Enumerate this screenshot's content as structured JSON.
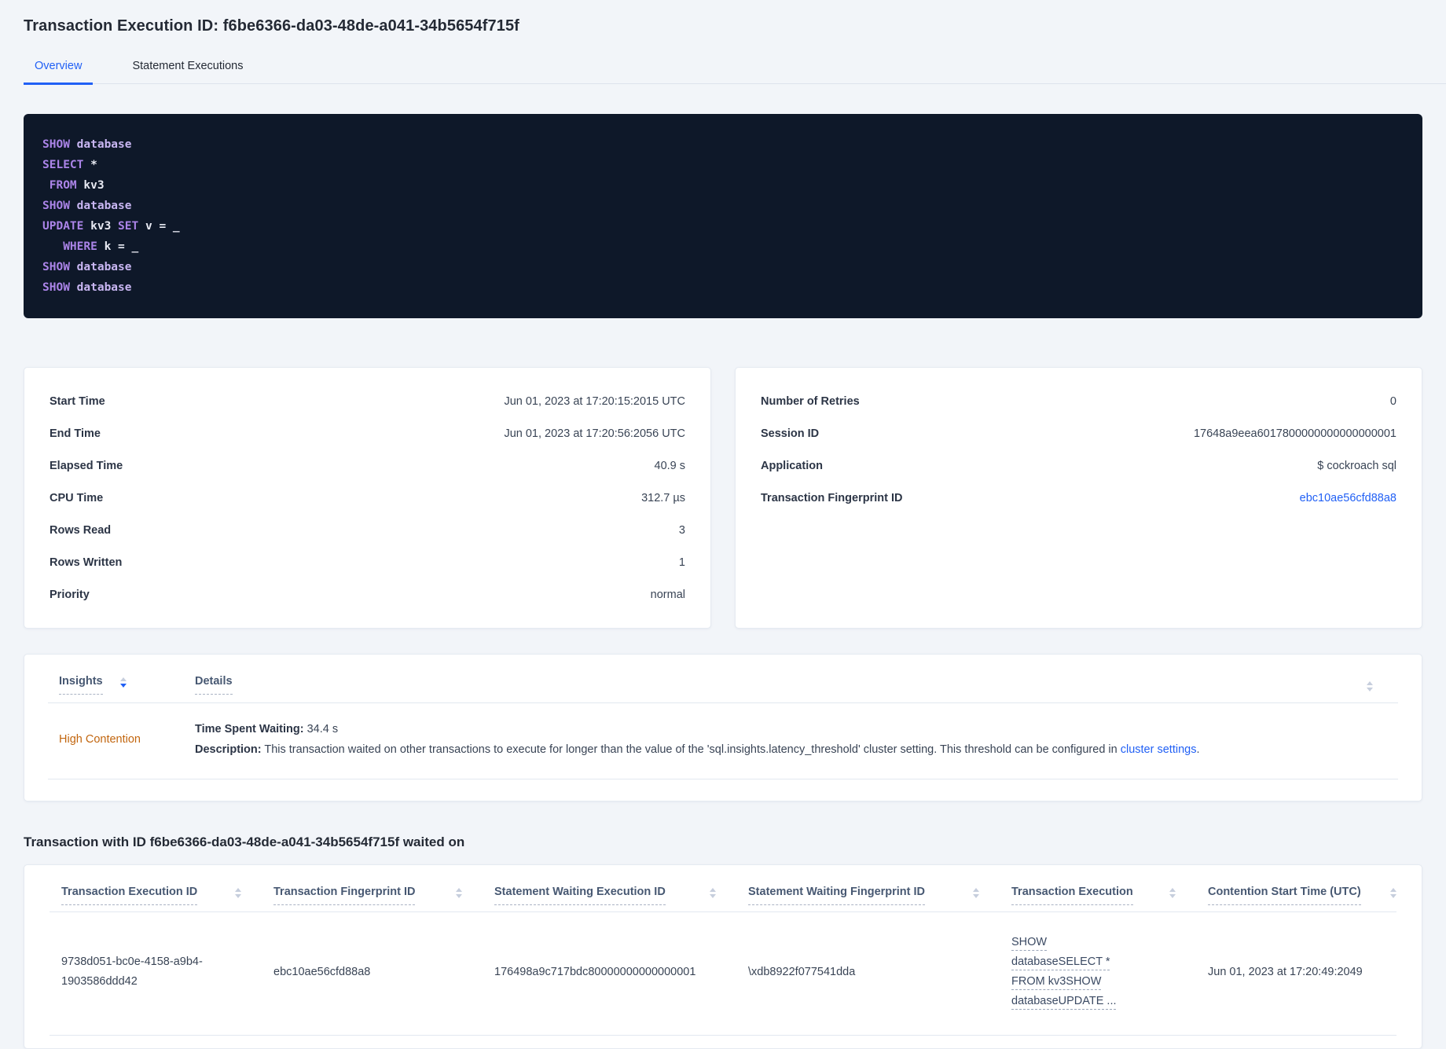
{
  "title": "Transaction Execution ID: f6be6366-da03-48de-a041-34b5654f715f",
  "tabs": {
    "overview": "Overview",
    "statements": "Statement Executions"
  },
  "sql": {
    "l1": [
      "SHOW",
      " database"
    ],
    "l2": [
      "SELECT",
      " *"
    ],
    "l3": [
      " FROM",
      " kv3"
    ],
    "l4": [
      "SHOW",
      " database"
    ],
    "l5": [
      "UPDATE",
      " kv3 ",
      "SET",
      " v = _"
    ],
    "l6": [
      "   WHERE",
      " k = _"
    ],
    "l7": [
      "SHOW",
      " database"
    ],
    "l8": [
      "SHOW",
      " database"
    ]
  },
  "summary": {
    "rows": [
      {
        "label": "Start Time",
        "value": "Jun 01, 2023 at 17:20:15:2015 UTC"
      },
      {
        "label": "End Time",
        "value": "Jun 01, 2023 at 17:20:56:2056 UTC"
      },
      {
        "label": "Elapsed Time",
        "value": "40.9 s"
      },
      {
        "label": "CPU Time",
        "value": "312.7 µs"
      },
      {
        "label": "Rows Read",
        "value": "3"
      },
      {
        "label": "Rows Written",
        "value": "1"
      },
      {
        "label": "Priority",
        "value": "normal"
      }
    ]
  },
  "meta": {
    "rows": [
      {
        "label": "Number of Retries",
        "value": "0"
      },
      {
        "label": "Session ID",
        "value": "17648a9eea6017800000000000000001"
      },
      {
        "label": "Application",
        "value": "$ cockroach sql"
      }
    ],
    "fingerprint_label": "Transaction Fingerprint ID",
    "fingerprint_value": "ebc10ae56cfd88a8"
  },
  "insights": {
    "col_insights": "Insights",
    "col_details": "Details",
    "row": {
      "name": "High Contention",
      "waiting_label": "Time Spent Waiting:",
      "waiting_value": " 34.4 s",
      "desc_label": "Description:",
      "desc_before": " This transaction waited on other transactions to execute for longer than the value of the 'sql.insights.latency_threshold' cluster setting. This threshold can be configured in ",
      "desc_link": "cluster settings",
      "desc_after": "."
    }
  },
  "waited": {
    "heading": "Transaction with ID f6be6366-da03-48de-a041-34b5654f715f waited on",
    "columns": [
      "Transaction Execution ID",
      "Transaction Fingerprint ID",
      "Statement Waiting Execution ID",
      "Statement Waiting Fingerprint ID",
      "Transaction Execution",
      "Contention Start Time (UTC)"
    ],
    "row": {
      "transaction_execution_id": "9738d051-bc0e-4158-a9b4-1903586ddd42",
      "transaction_fingerprint_id": "ebc10ae56cfd88a8",
      "statement_waiting_execution_id": "176498a9c717bdc80000000000000001",
      "statement_waiting_fingerprint_id": "\\xdb8922f077541dda",
      "transaction_execution": "SHOW databaseSELECT * FROM kv3SHOW databaseUPDATE ...",
      "contention_start_time": "Jun 01, 2023 at 17:20:49:2049"
    }
  },
  "colors": {
    "accent_blue": "#2160f5",
    "insight_orange": "#c2660f",
    "code_bg": "#0e1829"
  }
}
